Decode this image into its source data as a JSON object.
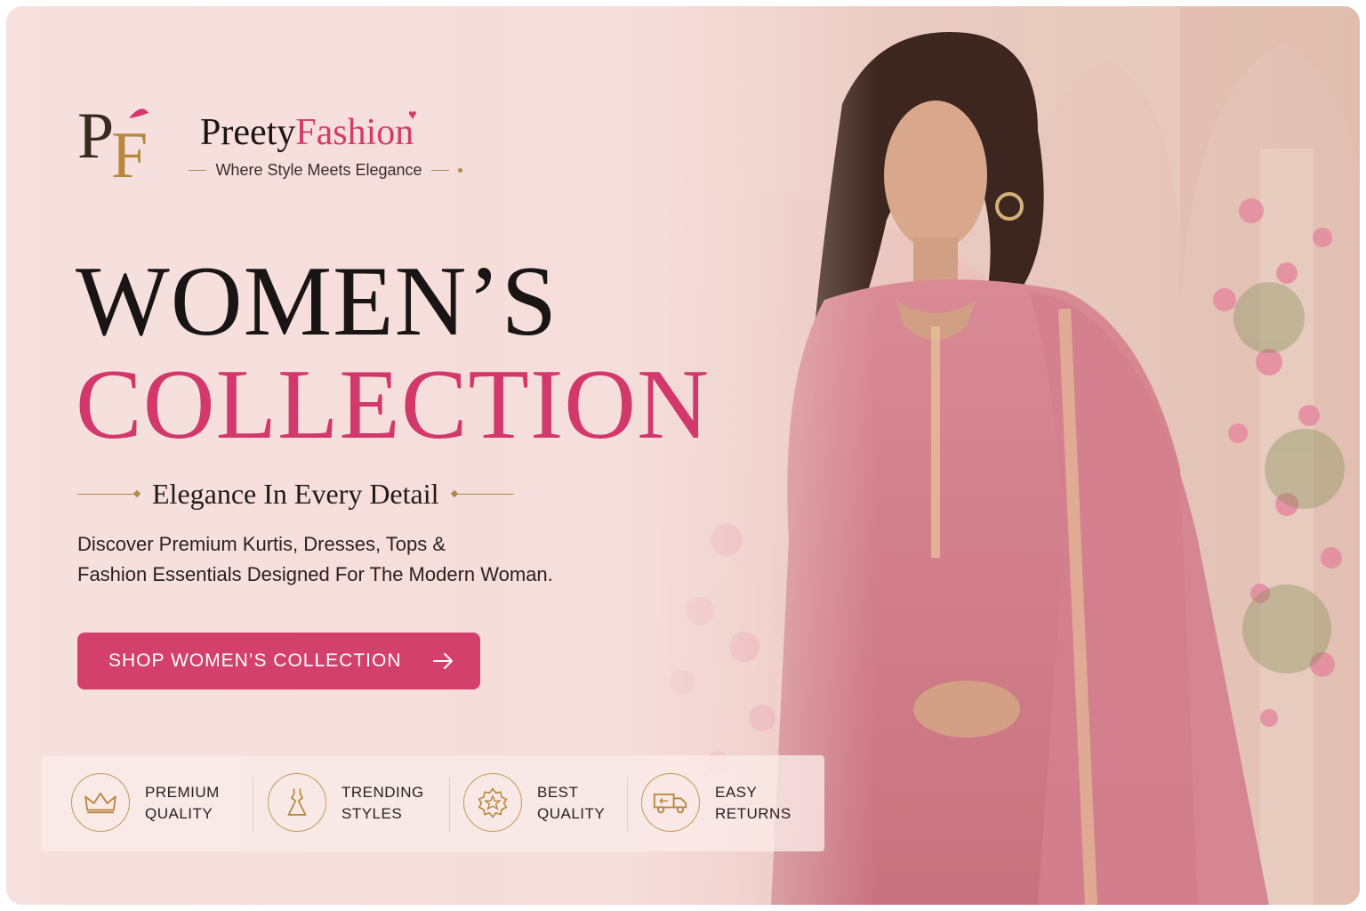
{
  "brand": {
    "name_part1": "Preety",
    "name_part2": "Fashion",
    "monogram": "PF",
    "tagline": "Where Style Meets Elegance"
  },
  "hero": {
    "headline_line1": "WOMEN’S",
    "headline_line2": "COLLECTION",
    "subheading": "Elegance In Every Detail",
    "description_line1": "Discover Premium Kurtis, Dresses, Tops &",
    "description_line2": "Fashion Essentials Designed For The Modern Woman.",
    "cta_label": "SHOP WOMEN’S COLLECTION"
  },
  "features": [
    {
      "line1": "PREMIUM",
      "line2": "QUALITY",
      "icon": "crown-icon"
    },
    {
      "line1": "TRENDING",
      "line2": "STYLES",
      "icon": "dress-icon"
    },
    {
      "line1": "BEST",
      "line2": "QUALITY",
      "icon": "star-badge-icon"
    },
    {
      "line1": "EASY",
      "line2": "RETURNS",
      "icon": "truck-icon"
    }
  ],
  "colors": {
    "accent": "#d2386a",
    "gold": "#c19a55",
    "dark": "#1a1515",
    "background": "#f6e1df"
  }
}
